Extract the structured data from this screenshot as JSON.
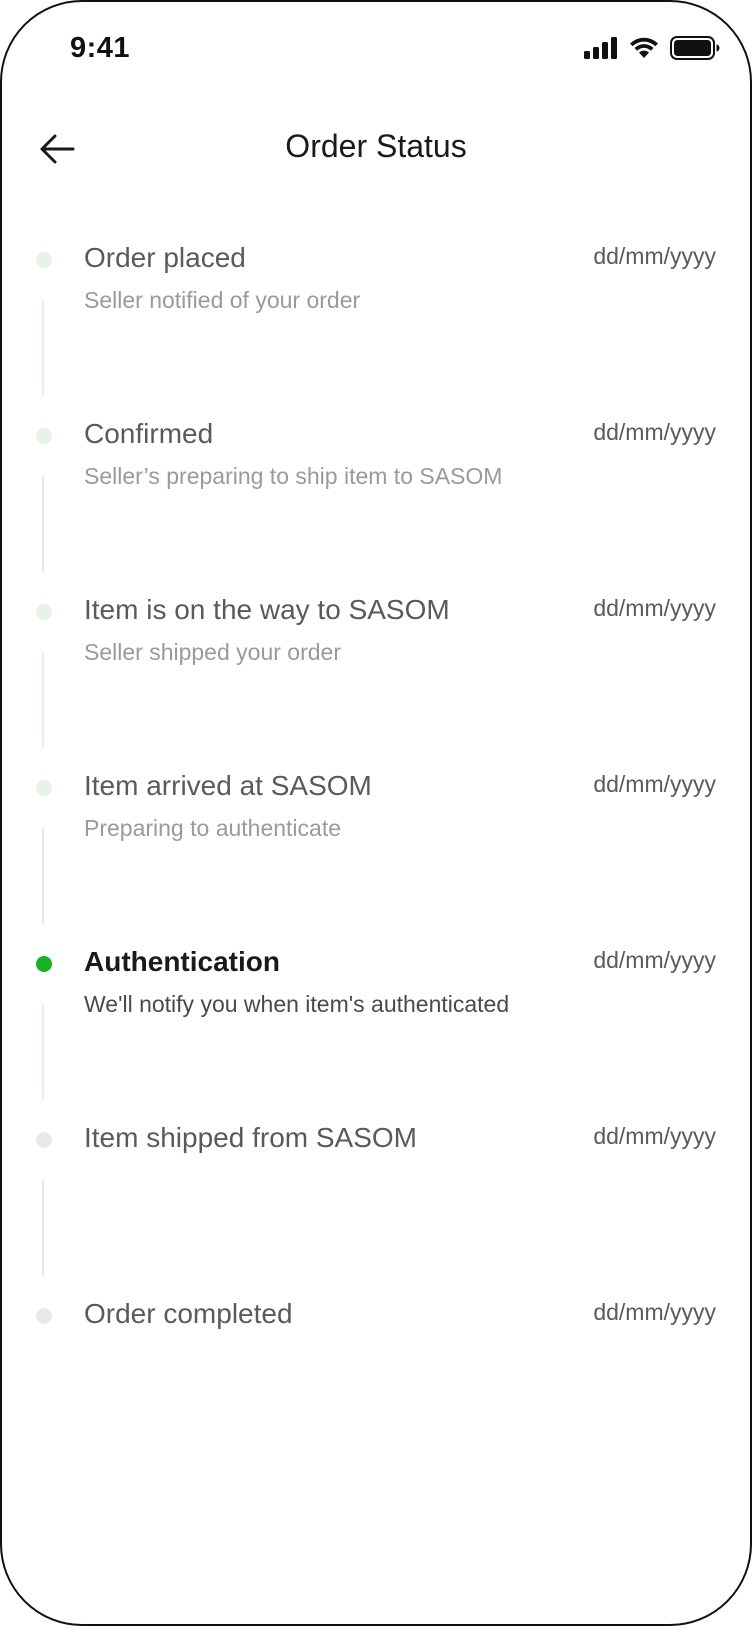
{
  "status_bar": {
    "time": "9:41"
  },
  "header": {
    "back_icon": "arrow-left-icon",
    "title": "Order Status"
  },
  "colors": {
    "current_dot": "#17b223",
    "done_dot": "#e5f4e7",
    "pending_dot": "#e9e9e9"
  },
  "steps": [
    {
      "title": "Order placed",
      "description": "Seller notified of your order",
      "date": "dd/mm/yyyy",
      "state": "done"
    },
    {
      "title": "Confirmed",
      "description": "Seller’s preparing to ship item to SASOM",
      "date": "dd/mm/yyyy",
      "state": "done"
    },
    {
      "title": "Item is on the way to SASOM",
      "description": "Seller shipped your order",
      "date": "dd/mm/yyyy",
      "state": "done"
    },
    {
      "title": "Item arrived at SASOM",
      "description": "Preparing to authenticate",
      "date": "dd/mm/yyyy",
      "state": "done"
    },
    {
      "title": "Authentication",
      "description": "We'll notify you when item's authenticated",
      "date": "dd/mm/yyyy",
      "state": "current"
    },
    {
      "title": "Item shipped from SASOM",
      "description": "",
      "date": "dd/mm/yyyy",
      "state": "pending"
    },
    {
      "title": "Order completed",
      "description": "",
      "date": "dd/mm/yyyy",
      "state": "pending"
    }
  ]
}
